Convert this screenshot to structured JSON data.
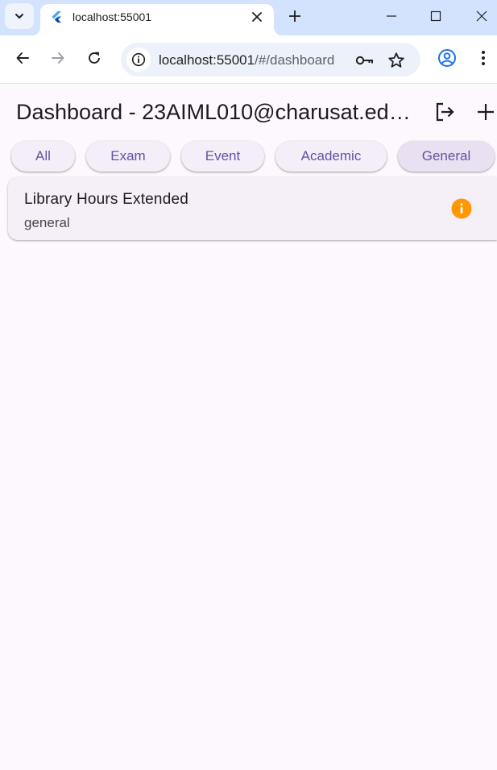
{
  "browser": {
    "tab_title": "localhost:55001",
    "url_host": "localhost:55001",
    "url_path": "/#/dashboard"
  },
  "app": {
    "title": "Dashboard - 23AIML010@charusat.edu.in",
    "filters": [
      {
        "label": "All",
        "selected": false
      },
      {
        "label": "Exam",
        "selected": false
      },
      {
        "label": "Event",
        "selected": false
      },
      {
        "label": "Academic",
        "selected": false
      },
      {
        "label": "General",
        "selected": true
      }
    ],
    "notices": [
      {
        "title": "Library Hours Extended",
        "category": "general",
        "icon": "info-icon",
        "icon_color": "#ff9800"
      }
    ]
  },
  "colors": {
    "accent": "#6750a4",
    "background": "#fdf7fe",
    "info": "#ff9800"
  }
}
